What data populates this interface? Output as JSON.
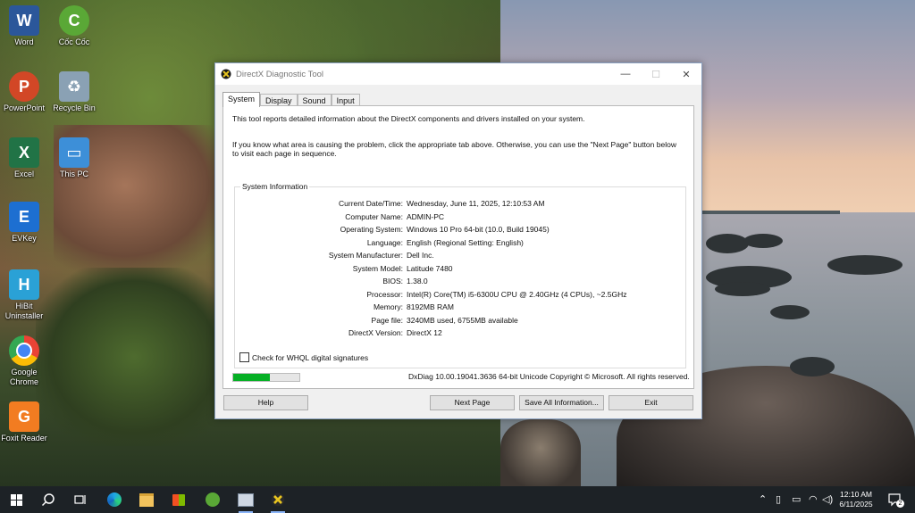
{
  "desktop": {
    "icons": [
      {
        "label": "Word",
        "glyph": "W",
        "color": "#2b579a"
      },
      {
        "label": "Cốc Cốc",
        "glyph": "C",
        "color": "#5aa836"
      },
      {
        "label": "PowerPoint",
        "glyph": "P",
        "color": "#d24726"
      },
      {
        "label": "Recycle Bin",
        "glyph": "♻",
        "color": "#8aa1b4"
      },
      {
        "label": "Excel",
        "glyph": "X",
        "color": "#217346"
      },
      {
        "label": "This PC",
        "glyph": "▭",
        "color": "#3d8fd8"
      },
      {
        "label": "EVKey",
        "glyph": "E",
        "color": "#1d6fd1"
      },
      {
        "label": "HiBit Uninstaller",
        "glyph": "H",
        "color": "#2aa1d6"
      },
      {
        "label": "Google Chrome",
        "glyph": "●",
        "color": "#e0453a"
      },
      {
        "label": "Foxit Reader",
        "glyph": "G",
        "color": "#f27c21"
      }
    ]
  },
  "dialog": {
    "title": "DirectX Diagnostic Tool",
    "tabs": [
      "System",
      "Display",
      "Sound",
      "Input"
    ],
    "active_tab": "System",
    "intro1": "This tool reports detailed information about the DirectX components and drivers installed on your system.",
    "intro2": "If you know what area is causing the problem, click the appropriate tab above.  Otherwise, you can use the \"Next Page\" button below to visit each page in sequence.",
    "group_label": "System Information",
    "rows": [
      {
        "label": "Current Date/Time:",
        "value": "Wednesday, June 11, 2025, 12:10:53 AM"
      },
      {
        "label": "Computer Name:",
        "value": "ADMIN-PC"
      },
      {
        "label": "Operating System:",
        "value": "Windows 10 Pro 64-bit (10.0, Build 19045)"
      },
      {
        "label": "Language:",
        "value": "English (Regional Setting: English)"
      },
      {
        "label": "System Manufacturer:",
        "value": "Dell Inc."
      },
      {
        "label": "System Model:",
        "value": "Latitude 7480"
      },
      {
        "label": "BIOS:",
        "value": "1.38.0"
      },
      {
        "label": "Processor:",
        "value": "Intel(R) Core(TM) i5-6300U CPU @ 2.40GHz (4 CPUs), ~2.5GHz"
      },
      {
        "label": "Memory:",
        "value": "8192MB RAM"
      },
      {
        "label": "Page file:",
        "value": "3240MB used, 6755MB available"
      },
      {
        "label": "DirectX Version:",
        "value": "DirectX 12"
      }
    ],
    "whql_label": "Check for WHQL digital signatures",
    "whql_checked": false,
    "progress_fraction": 0.55,
    "footer": "DxDiag 10.00.19041.3636 64-bit Unicode  Copyright © Microsoft. All rights reserved.",
    "buttons": {
      "help": "Help",
      "next": "Next Page",
      "save": "Save All Information...",
      "exit": "Exit"
    }
  },
  "taskbar": {
    "time": "12:10 AM",
    "date": "6/11/2025",
    "notification_count": "2"
  }
}
